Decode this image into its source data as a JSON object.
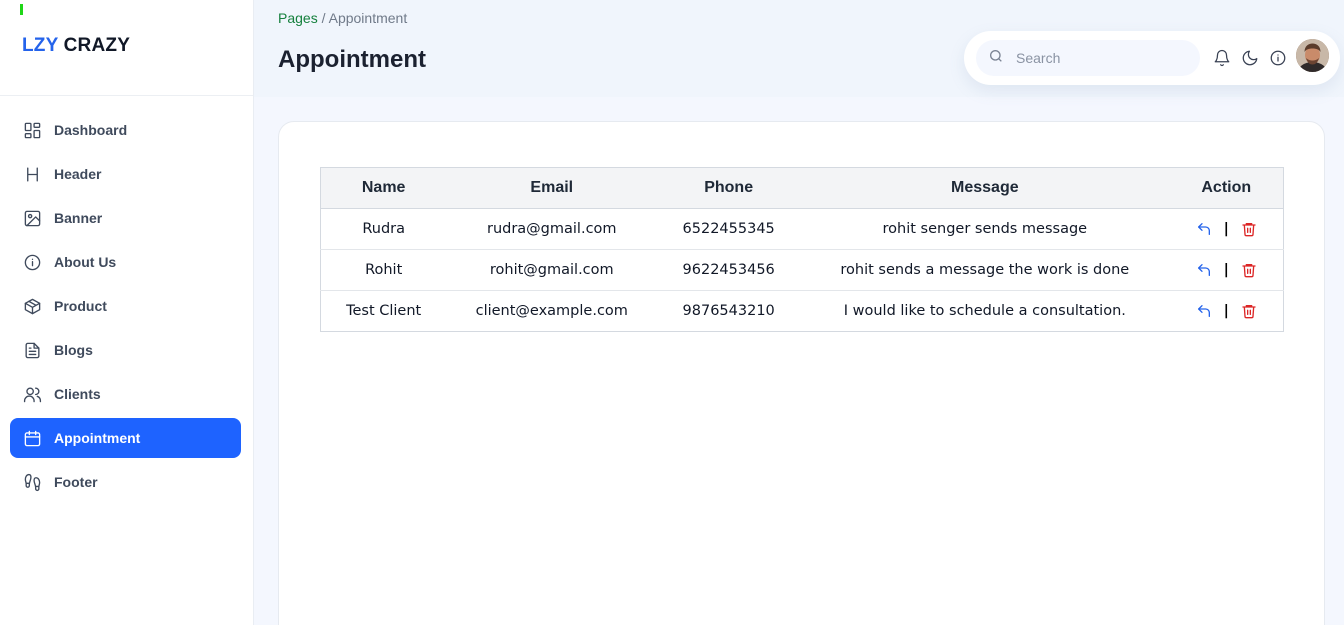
{
  "brand": {
    "part1": "LZY",
    "part2": "CRAZY"
  },
  "sidebar": {
    "items": [
      {
        "label": "Dashboard",
        "icon": "dashboard-icon"
      },
      {
        "label": "Header",
        "icon": "heading-icon"
      },
      {
        "label": "Banner",
        "icon": "image-icon"
      },
      {
        "label": "About Us",
        "icon": "info-icon"
      },
      {
        "label": "Product",
        "icon": "box-icon"
      },
      {
        "label": "Blogs",
        "icon": "document-icon"
      },
      {
        "label": "Clients",
        "icon": "users-icon"
      },
      {
        "label": "Appointment",
        "icon": "calendar-icon",
        "active": true
      },
      {
        "label": "Footer",
        "icon": "footprints-icon"
      }
    ]
  },
  "header": {
    "breadcrumb_root": "Pages",
    "breadcrumb_sep": " / ",
    "breadcrumb_current": "Appointment",
    "title": "Appointment",
    "search_placeholder": "Search",
    "icons": [
      "bell-icon",
      "moon-icon",
      "info-icon",
      "avatar"
    ]
  },
  "table": {
    "columns": [
      "Name",
      "Email",
      "Phone",
      "Message",
      "Action"
    ],
    "rows": [
      {
        "name": "Rudra",
        "email": "rudra@gmail.com",
        "phone": "6522455345",
        "message": "rohit senger sends message"
      },
      {
        "name": "Rohit",
        "email": "rohit@gmail.com",
        "phone": "9622453456",
        "message": "rohit sends a message the work is done"
      },
      {
        "name": "Test Client",
        "email": "client@example.com",
        "phone": "9876543210",
        "message": "I would like to schedule a consultation."
      }
    ],
    "action_separator": "|"
  },
  "colors": {
    "accent": "#1e63ff",
    "delete": "#dc2626",
    "reply": "#2563eb",
    "breadcrumb_root": "#15803d"
  }
}
